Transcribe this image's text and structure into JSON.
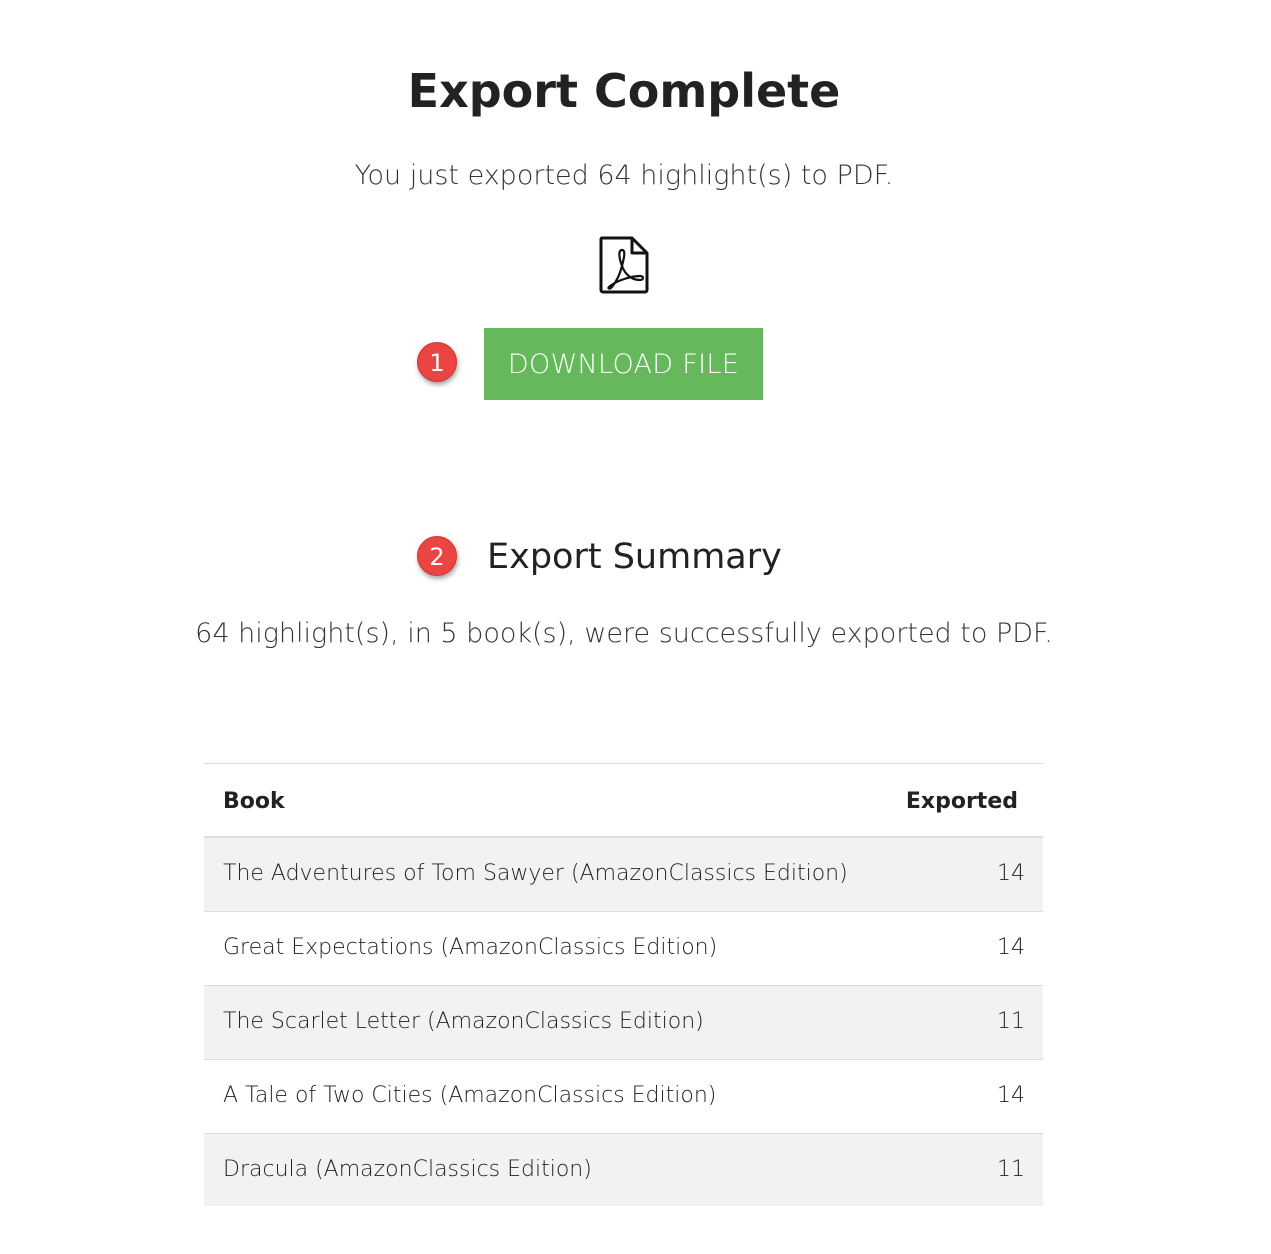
{
  "header": {
    "title": "Export Complete",
    "subtitle": "You just exported 64 highlight(s) to PDF.",
    "file_icon": "pdf-file-icon"
  },
  "annotations": {
    "marker_1": "1",
    "marker_2": "2",
    "marker_color": "#ea4443"
  },
  "download": {
    "label": "DOWNLOAD FILE",
    "color": "#66b85c"
  },
  "summary": {
    "title": "Export Summary",
    "text": "64 highlight(s), in 5 book(s), were successfully exported to PDF."
  },
  "table": {
    "columns": [
      "Book",
      "Exported"
    ],
    "rows": [
      {
        "book": "The Adventures of Tom Sawyer (AmazonClassics Edition)",
        "exported": "14"
      },
      {
        "book": "Great Expectations (AmazonClassics Edition)",
        "exported": "14"
      },
      {
        "book": "The Scarlet Letter (AmazonClassics Edition)",
        "exported": "11"
      },
      {
        "book": "A Tale of Two Cities (AmazonClassics Edition)",
        "exported": "14"
      },
      {
        "book": "Dracula (AmazonClassics Edition)",
        "exported": "11"
      }
    ]
  }
}
